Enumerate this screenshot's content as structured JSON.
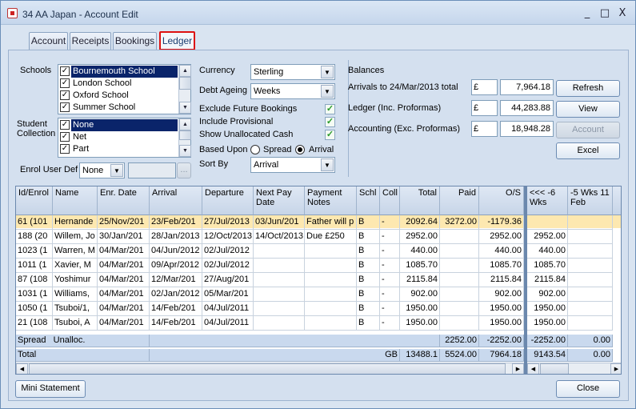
{
  "window": {
    "title": "34 AA Japan - Account Edit",
    "minimize": "_",
    "maximize": "□",
    "close": "X"
  },
  "tabs": [
    {
      "label": "Account"
    },
    {
      "label": "Receipts"
    },
    {
      "label": "Bookings"
    },
    {
      "label": "Ledger"
    }
  ],
  "filters": {
    "schools_label": "Schools",
    "schools": [
      "Bournemouth School",
      "London School",
      "Oxford School",
      "Summer School"
    ],
    "student_collection_label": "Student Collection",
    "collections": [
      "None",
      "Net",
      "Part"
    ],
    "enrol_user_def_label": "Enrol User Def",
    "enrol_user_def_value": "None",
    "ellipsis": "...",
    "currency_label": "Currency",
    "currency_value": "Sterling",
    "debt_ageing_label": "Debt Ageing",
    "debt_ageing_value": "Weeks",
    "exclude_future_label": "Exclude Future Bookings",
    "include_provisional_label": "Include Provisional",
    "show_unallocated_label": "Show Unallocated Cash",
    "check_mark": "✓",
    "based_upon_label": "Based Upon",
    "spread_label": "Spread",
    "arrival_label": "Arrival",
    "sort_by_label": "Sort By",
    "sort_by_value": "Arrival"
  },
  "balances": {
    "title": "Balances",
    "rows": [
      {
        "label": "Arrivals to 24/Mar/2013 total",
        "currency": "£",
        "value": "7,964.18"
      },
      {
        "label": "Ledger (Inc. Proformas)",
        "currency": "£",
        "value": "44,283.88"
      },
      {
        "label": "Accounting (Exc. Proformas)",
        "currency": "£",
        "value": "18,948.28"
      }
    ],
    "buttons": {
      "refresh": "Refresh",
      "view": "View",
      "account": "Account",
      "excel": "Excel"
    }
  },
  "grid": {
    "headers": [
      "Id/Enrol",
      "Name",
      "Enr. Date",
      "Arrival",
      "Departure",
      "Next Pay Date",
      "Payment Notes",
      "Schl",
      "Coll",
      "Total",
      "Paid",
      "O/S",
      "<<< -6 Wks",
      "-5 Wks 11 Feb"
    ],
    "rows": [
      [
        "61  (101",
        "Hernande",
        "25/Nov/201",
        "23/Feb/201",
        "27/Jul/2013",
        "03/Jun/201",
        "Father will p",
        "B",
        "-",
        "2092.64",
        "3272.00",
        "-1179.36",
        "",
        ""
      ],
      [
        "188  (20",
        "Willem, Jo",
        "30/Jan/201",
        "28/Jan/2013",
        "12/Oct/2013",
        "14/Oct/2013",
        "Due £250",
        "B",
        "-",
        "2952.00",
        "",
        "2952.00",
        "2952.00",
        ""
      ],
      [
        "1023  (1",
        "Warren, M",
        "04/Mar/201",
        "04/Jun/2012",
        "02/Jul/2012",
        "",
        "",
        "B",
        "-",
        "440.00",
        "",
        "440.00",
        "440.00",
        ""
      ],
      [
        "1011  (1",
        "Xavier, M",
        "04/Mar/201",
        "09/Apr/2012",
        "02/Jul/2012",
        "",
        "",
        "B",
        "-",
        "1085.70",
        "",
        "1085.70",
        "1085.70",
        ""
      ],
      [
        "87  (108",
        "Yoshimur",
        "04/Mar/201",
        "12/Mar/201",
        "27/Aug/201",
        "",
        "",
        "B",
        "-",
        "2115.84",
        "",
        "2115.84",
        "2115.84",
        ""
      ],
      [
        "1031  (1",
        "Williams,",
        "04/Mar/201",
        "02/Jan/2012",
        "05/Mar/201",
        "",
        "",
        "B",
        "-",
        "902.00",
        "",
        "902.00",
        "902.00",
        ""
      ],
      [
        "1050  (1",
        "Tsuboi/1,",
        "04/Mar/201",
        "14/Feb/201",
        "04/Jul/2011",
        "",
        "",
        "B",
        "-",
        "1950.00",
        "",
        "1950.00",
        "1950.00",
        ""
      ],
      [
        "21  (108",
        "Tsuboi, A",
        "04/Mar/201",
        "14/Feb/201",
        "04/Jul/2011",
        "",
        "",
        "B",
        "-",
        "1950.00",
        "",
        "1950.00",
        "1950.00",
        ""
      ]
    ],
    "spread_row": {
      "label1": "Spread",
      "label2": "Unalloc.",
      "paid": "2252.00",
      "os": "-2252.00",
      "w6": "-2252.00",
      "w5": "0.00"
    },
    "total_row": {
      "label": "Total",
      "schl": "GB",
      "total": "13488.1",
      "paid": "5524.00",
      "os": "7964.18",
      "w6": "9143.54",
      "w5": "0.00"
    }
  },
  "footer": {
    "mini_statement": "Mini Statement",
    "close": "Close"
  }
}
